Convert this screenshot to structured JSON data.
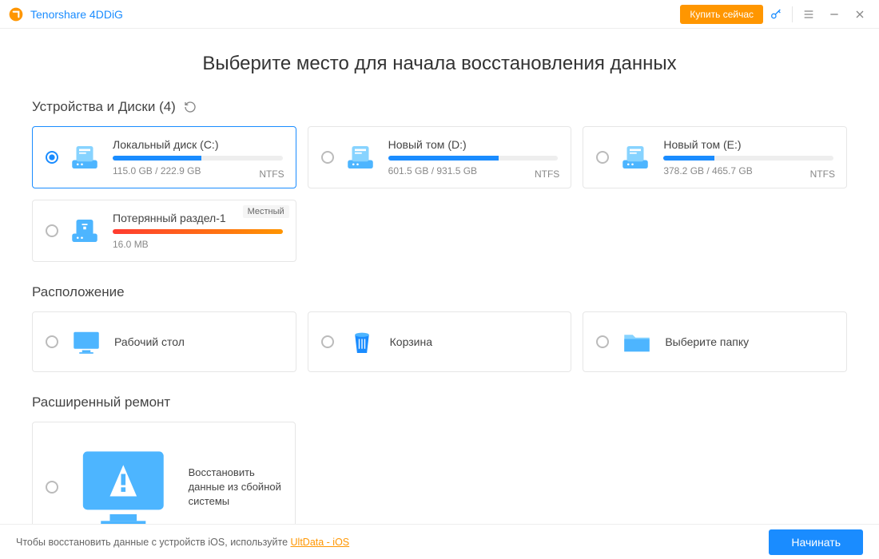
{
  "titlebar": {
    "app_name": "Tenorshare 4DDiG",
    "buy_label": "Купить сейчас"
  },
  "heading": "Выберите место для начала восстановления данных",
  "devices": {
    "title_prefix": "Устройства и Диски",
    "count": "(4)",
    "drives": [
      {
        "name": "Локальный диск (C:)",
        "size": "115.0 GB / 222.9 GB",
        "fs": "NTFS",
        "fill": 52,
        "selected": true,
        "color": "blue"
      },
      {
        "name": "Новый том (D:)",
        "size": "601.5 GB / 931.5 GB",
        "fs": "NTFS",
        "fill": 65,
        "selected": false,
        "color": "blue"
      },
      {
        "name": "Новый том (E:)",
        "size": "378.2 GB / 465.7 GB",
        "fs": "NTFS",
        "fill": 30,
        "selected": false,
        "color": "blue"
      },
      {
        "name": "Потерянный раздел-1",
        "size": "16.0 MB",
        "fs": "",
        "fill": 100,
        "selected": false,
        "color": "orange",
        "badge": "Местный"
      }
    ]
  },
  "locations": {
    "title": "Расположение",
    "items": [
      {
        "label": "Рабочий стол",
        "icon": "monitor"
      },
      {
        "label": "Корзина",
        "icon": "trash"
      },
      {
        "label": "Выберите папку",
        "icon": "folder"
      }
    ]
  },
  "repair": {
    "title": "Расширенный ремонт",
    "label": "Восстановить данные из сбойной системы"
  },
  "footer": {
    "hint_prefix": "Чтобы восстановить данные с устройств iOS, используйте ",
    "hint_link": "UltData - iOS",
    "start_label": "Начинать"
  }
}
